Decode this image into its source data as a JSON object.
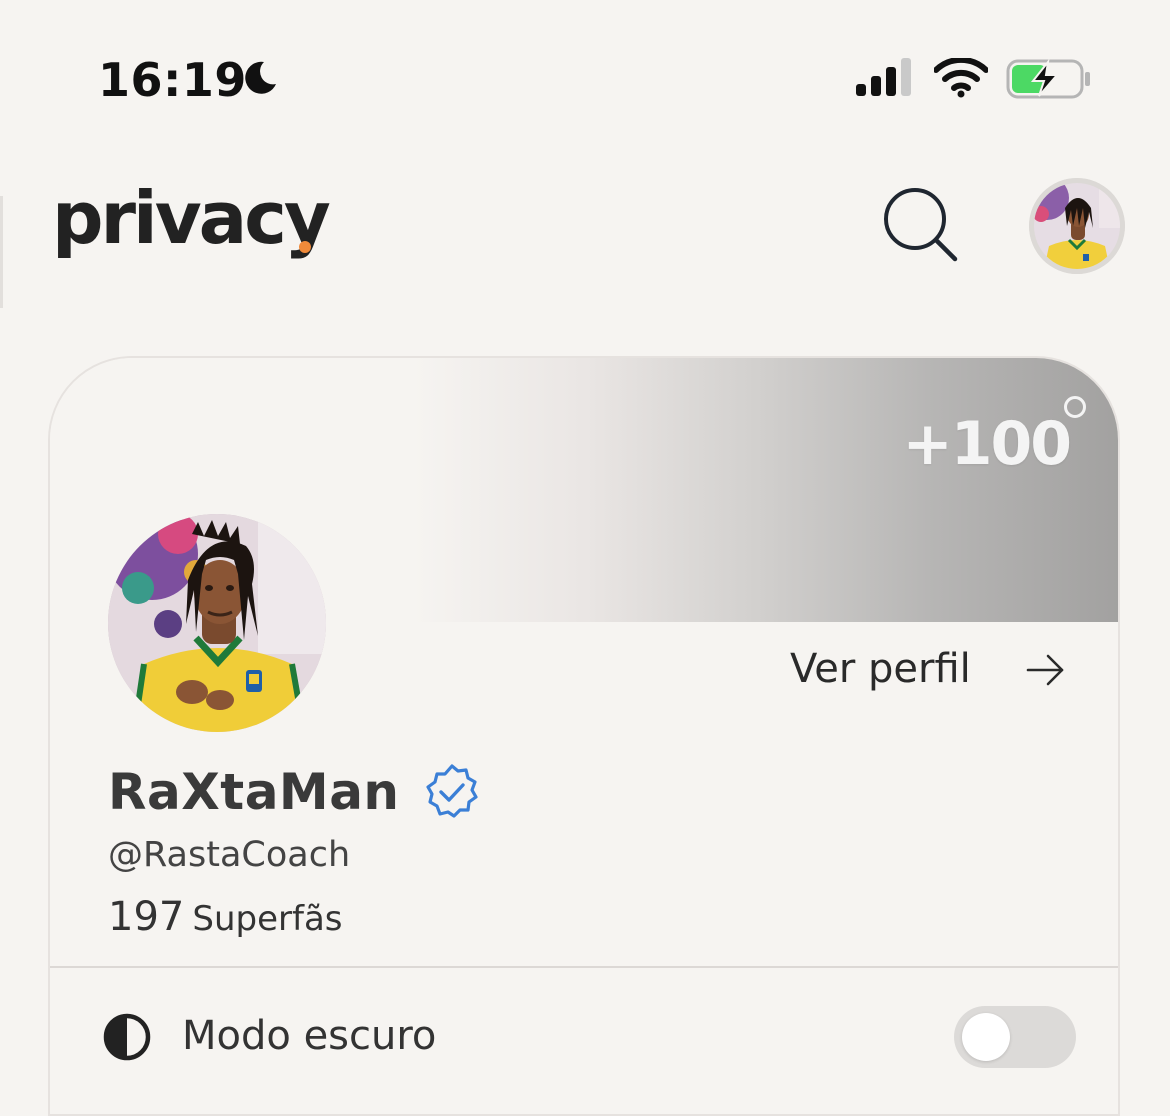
{
  "status_bar": {
    "time": "16:19",
    "icons": [
      "moon-icon",
      "cellular-signal-icon",
      "wifi-icon",
      "battery-charging-icon"
    ],
    "battery_color": "#4cd964"
  },
  "header": {
    "logo_text": "privacy",
    "logo_dot_color": "#f08a3a",
    "search_icon": "search-icon"
  },
  "profile_card": {
    "cover_badge": "+100",
    "view_profile_label": "Ver perfil",
    "display_name": "RaXtaMan",
    "verified_color": "#3b7fd6",
    "handle": "@RastaCoach",
    "fans_count": "197",
    "fans_label": "Superfãs",
    "dark_mode_label": "Modo escuro",
    "dark_mode_enabled": false
  }
}
